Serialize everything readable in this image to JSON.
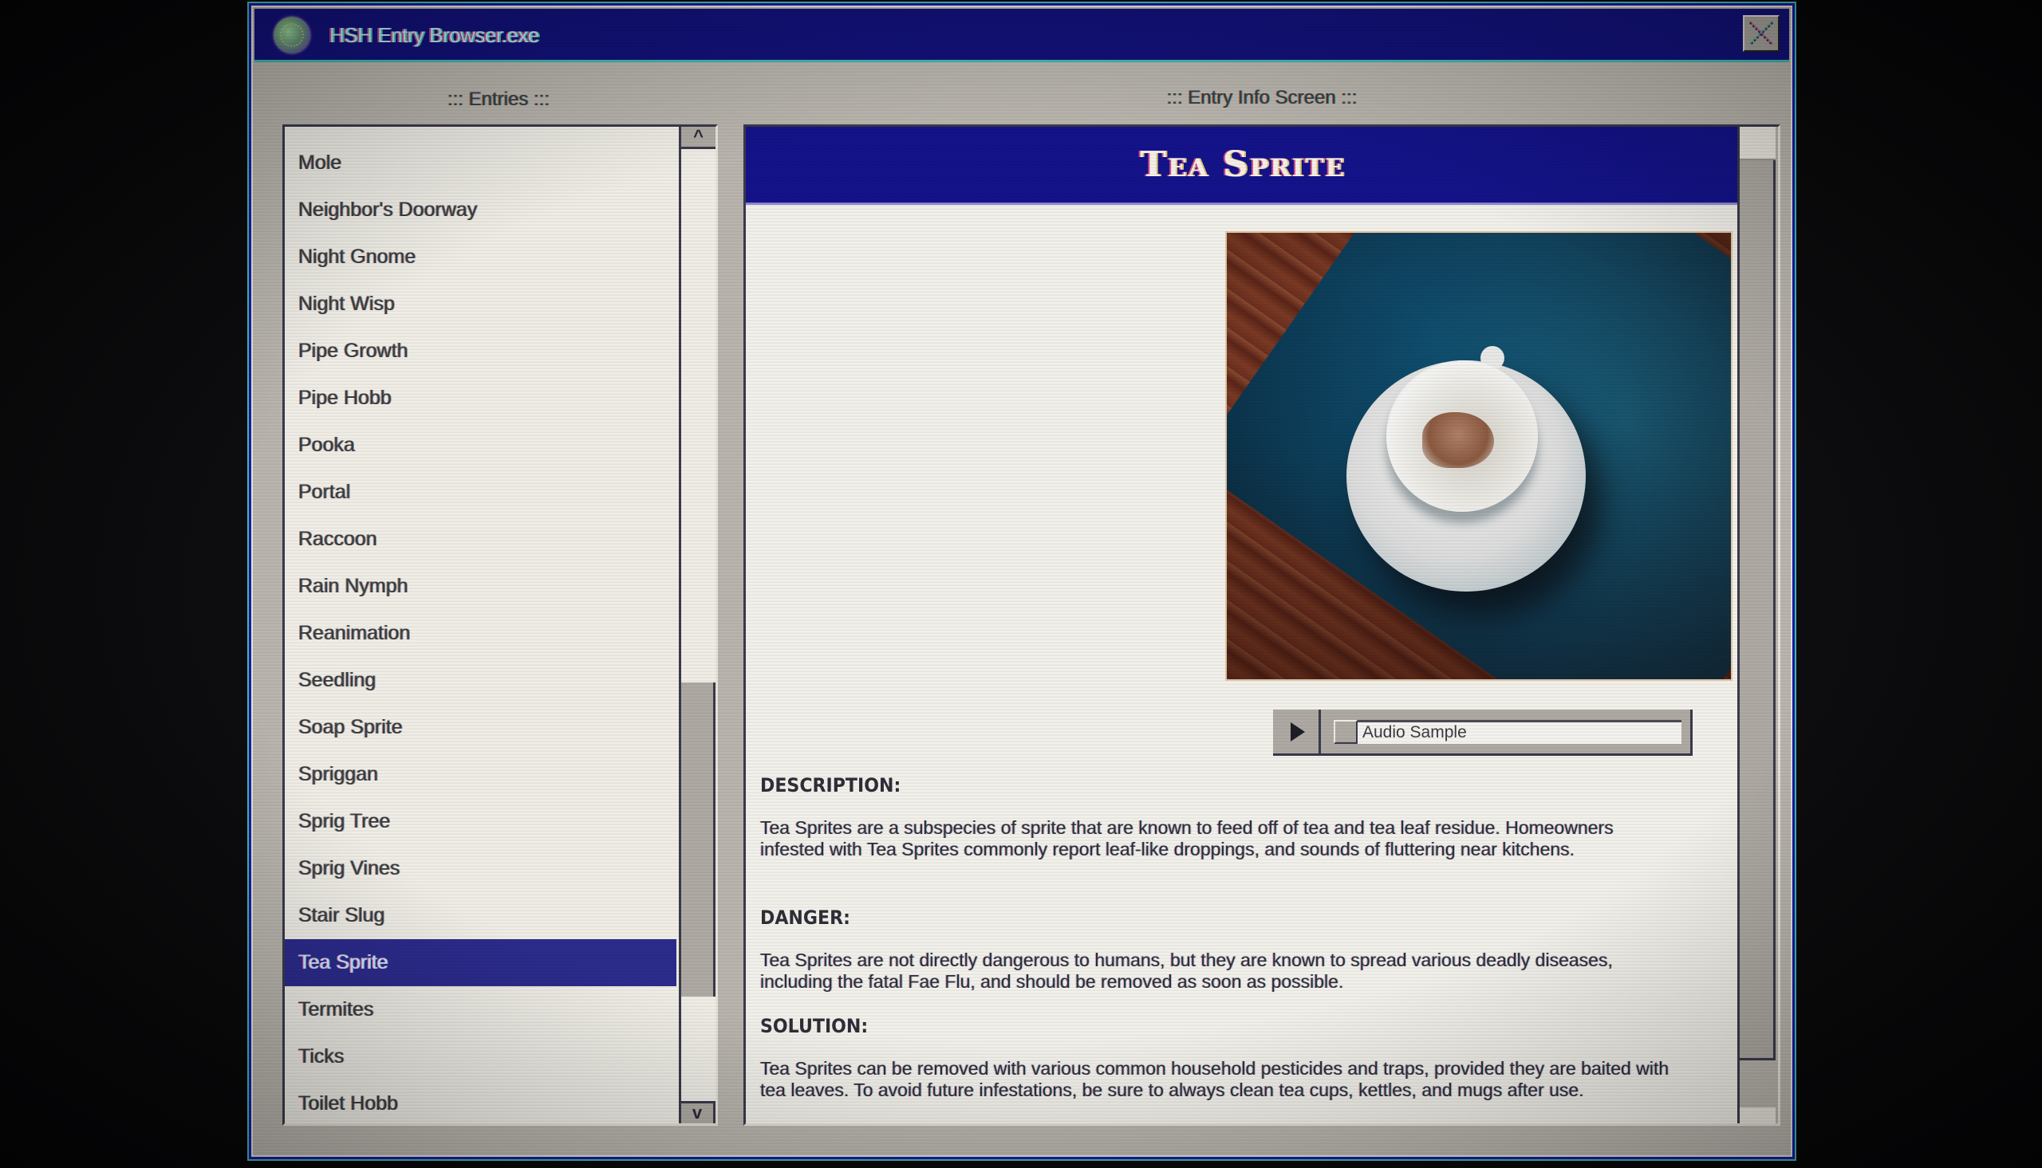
{
  "window": {
    "title": "HSH Entry Browser.exe",
    "app_icon": "globe-icon",
    "close_icon": "close-icon"
  },
  "entries_panel": {
    "label": "::: Entries :::",
    "items": [
      {
        "label": "Mole"
      },
      {
        "label": "Neighbor's Doorway"
      },
      {
        "label": "Night Gnome"
      },
      {
        "label": "Night Wisp"
      },
      {
        "label": "Pipe Growth"
      },
      {
        "label": "Pipe Hobb"
      },
      {
        "label": "Pooka"
      },
      {
        "label": "Portal"
      },
      {
        "label": "Raccoon"
      },
      {
        "label": "Rain Nymph"
      },
      {
        "label": "Reanimation"
      },
      {
        "label": "Seedling"
      },
      {
        "label": "Soap Sprite"
      },
      {
        "label": "Spriggan"
      },
      {
        "label": "Sprig Tree"
      },
      {
        "label": "Sprig Vines"
      },
      {
        "label": "Stair Slug"
      },
      {
        "label": "Tea Sprite"
      },
      {
        "label": "Termites"
      },
      {
        "label": "Ticks"
      },
      {
        "label": "Toilet Hobb"
      }
    ],
    "selected_index": 17,
    "scroll_up_label": "^",
    "scroll_down_label": "v",
    "scroll_position": 0.56,
    "scroll_thumb_fraction": 0.33
  },
  "info_panel": {
    "label": "::: Entry Info Screen :::",
    "title": "Tea Sprite",
    "image_alt": "Teacup on saucer on a wooden table with blue cloth",
    "audio": {
      "play_icon": "play-icon",
      "label": "Audio Sample"
    },
    "sections": {
      "description": {
        "heading": "DESCRIPTION:",
        "body": "Tea Sprites are a subspecies of sprite that are known to feed off of tea and tea leaf residue. Homeowners infested with Tea Sprites commonly report leaf-like droppings, and sounds of fluttering near kitchens."
      },
      "danger": {
        "heading": "DANGER:",
        "body": "Tea Sprites are not directly dangerous to humans, but they are known to spread various deadly diseases, including the fatal Fae Flu, and should be removed as soon as possible."
      },
      "solution": {
        "heading": "SOLUTION:",
        "body": "Tea Sprites can be removed with various common household pesticides and traps, provided they are baited with tea leaves. To avoid future infestations, be sure to always clean tea cups, kettles, and mugs after use."
      }
    },
    "scroll_position": 0.0,
    "scroll_thumb_fraction": 0.95
  },
  "colors": {
    "titlebar": "#12117a",
    "selection": "#2b2b8c",
    "window_bg": "#b9b5ae",
    "panel_bg": "#efede6",
    "accent_cyan": "#3fb7b0"
  }
}
